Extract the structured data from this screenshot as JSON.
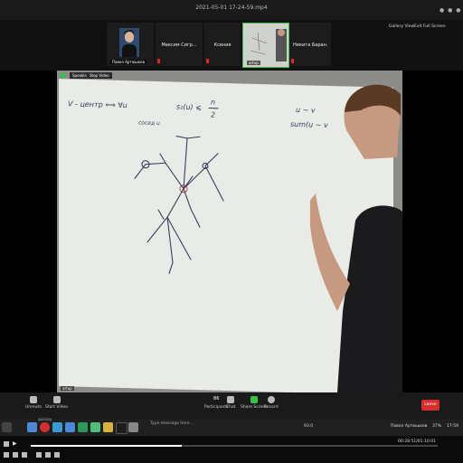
{
  "window": {
    "title": "2021-05-01 17-24-59.mp4"
  },
  "top_bar": {
    "gallery_view": "Gallery View",
    "exit_fullscreen": "Exit Full Screen"
  },
  "participants": [
    {
      "name": "Павел Артюшков",
      "has_video": true
    },
    {
      "name": "Максим Сигр...",
      "has_video": false
    },
    {
      "name": "Ксения",
      "has_video": false
    },
    {
      "name": "artup",
      "has_video": true
    },
    {
      "name": "Никита Баран...",
      "has_video": false
    }
  ],
  "video": {
    "speaking_label": "Speaking",
    "stop_video_label": "Stop Video",
    "footer_label": "artup"
  },
  "whiteboard": {
    "line1_left": "V - центр ⟺ ∀u",
    "line1_mid": "s₂(u) ⩽",
    "frac_num": "n",
    "frac_den": "2",
    "line2": "сосед u",
    "right1": "u ∼ v",
    "right2": "sum(u ∼ v"
  },
  "toolbar": {
    "unmute": "Unmute",
    "start_video": "Start Video",
    "participants_count": "86",
    "participants": "Participants",
    "chat": "Chat",
    "share_screen": "Share Screen",
    "record": "Record",
    "leave": "Leave",
    "chat_placeholder": "Type message here..."
  },
  "dock": {
    "left_label": "quickey",
    "right_name": "Павел Артюшков",
    "battery": "37%",
    "clock": "17:59",
    "tray_num": "93.0"
  },
  "media": {
    "progress": 0.37,
    "time": "00:28:51/01:10:01"
  },
  "colors": {
    "leave": "#d42e2e",
    "marker": "#3a3d5c",
    "board": "#e9ebe7",
    "share_green": "#35c24a"
  }
}
